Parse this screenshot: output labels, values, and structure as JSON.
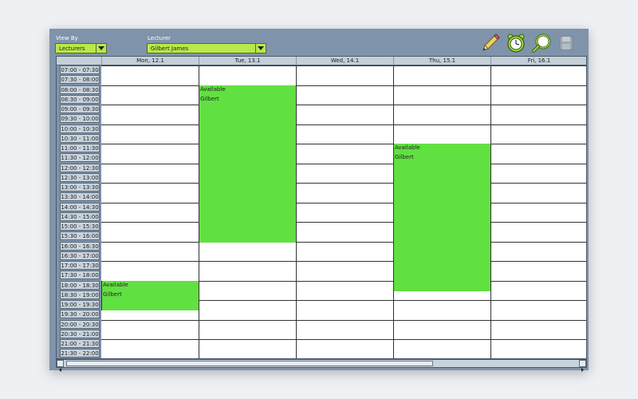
{
  "toolbar": {
    "view_by_label": "View By",
    "view_by_value": "Lecturers",
    "lecturer_label": "Lecturer",
    "lecturer_value": "Gilbert James",
    "tools": [
      {
        "icon": "pencil-icon"
      },
      {
        "icon": "alarm-clock-icon"
      },
      {
        "icon": "magnifier-icon"
      },
      {
        "icon": "save-disk-icon"
      }
    ]
  },
  "days": [
    "Mon, 12.1",
    "Tue, 13.1",
    "Wed, 14.1",
    "Thu, 15.1",
    "Fri, 16.1"
  ],
  "time_slots": [
    "07:00 - 07:30",
    "07:30 - 08:00",
    "08:00 - 08:30",
    "08:30 - 09:00",
    "09:00 - 09:30",
    "09:30 - 10:00",
    "10:00 - 10:30",
    "10:30 - 11:00",
    "11:00 - 11:30",
    "11:30 - 12:00",
    "12:00 - 12:30",
    "12:30 - 13:00",
    "13:00 - 13:30",
    "13:30 - 14:00",
    "14:00 - 14:30",
    "14:30 - 15:00",
    "15:00 - 15:30",
    "15:30 - 16:00",
    "16:00 - 16:30",
    "16:30 - 17:00",
    "17:00 - 17:30",
    "17:30 - 18:00",
    "18:00 - 18:30",
    "18:30 - 19:00",
    "19:00 - 19:30",
    "19:30 - 20:00",
    "20:00 - 20:30",
    "20:30 - 21:00",
    "21:00 - 21:30",
    "21:30 - 22:00"
  ],
  "events": [
    {
      "day": 1,
      "start": "08:00",
      "end": "16:00",
      "title": "Available",
      "person": "Gilbert"
    },
    {
      "day": 3,
      "start": "11:00",
      "end": "18:30",
      "title": "Available",
      "person": "Gilbert"
    },
    {
      "day": 0,
      "start": "18:00",
      "end": "19:30",
      "title": "Available",
      "person": "Gilbert"
    }
  ],
  "colors": {
    "event_fill": "#61e042",
    "combo_fill": "#b9e84a",
    "window_bg": "#7f93aa"
  }
}
